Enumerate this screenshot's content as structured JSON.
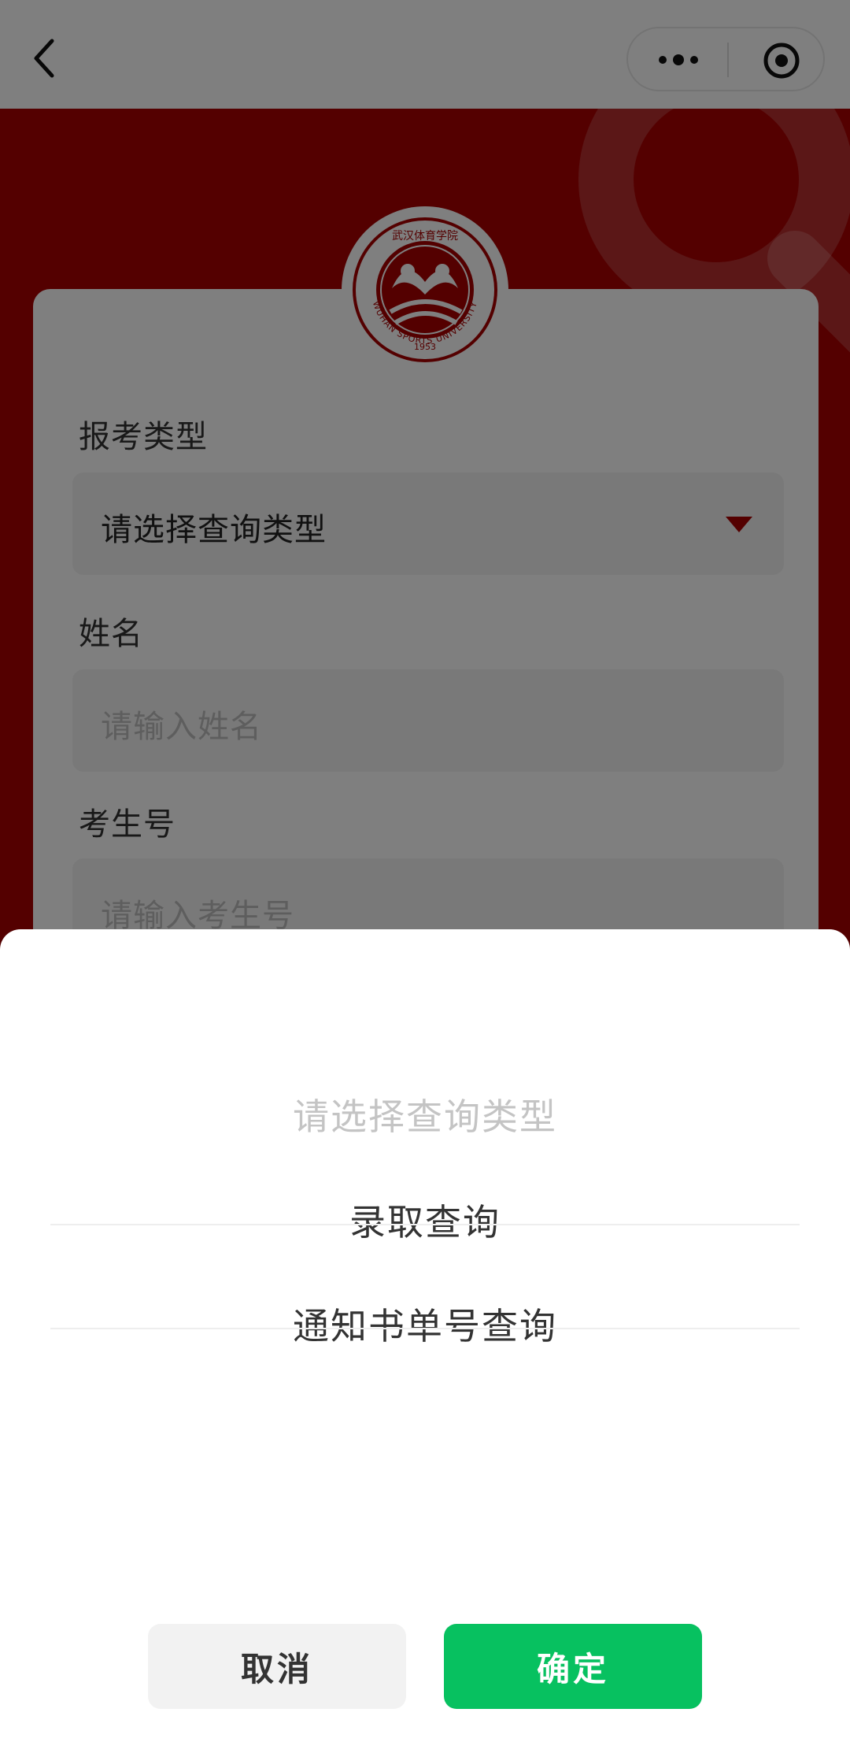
{
  "form": {
    "exam_type": {
      "label": "报考类型",
      "value": "请选择查询类型"
    },
    "name": {
      "label": "姓名",
      "placeholder": "请输入姓名"
    },
    "candidate_no": {
      "label": "考生号",
      "placeholder": "请输入考生号"
    }
  },
  "logo": {
    "university": "WUHAN SPORTS UNIVERSITY",
    "year": "1953"
  },
  "picker": {
    "options": [
      "请选择查询类型",
      "录取查询",
      "通知书单号查询"
    ],
    "cancel_label": "取消",
    "confirm_label": "确定"
  },
  "colors": {
    "brand_red": "#a80000",
    "confirm_green": "#07c160"
  },
  "icons": {
    "nav_back": "back-chevron-icon",
    "nav_more": "more-dots-icon",
    "nav_close": "close-circle-icon",
    "dropdown": "triangle-down-icon",
    "decoration": "magnifier-icon"
  }
}
